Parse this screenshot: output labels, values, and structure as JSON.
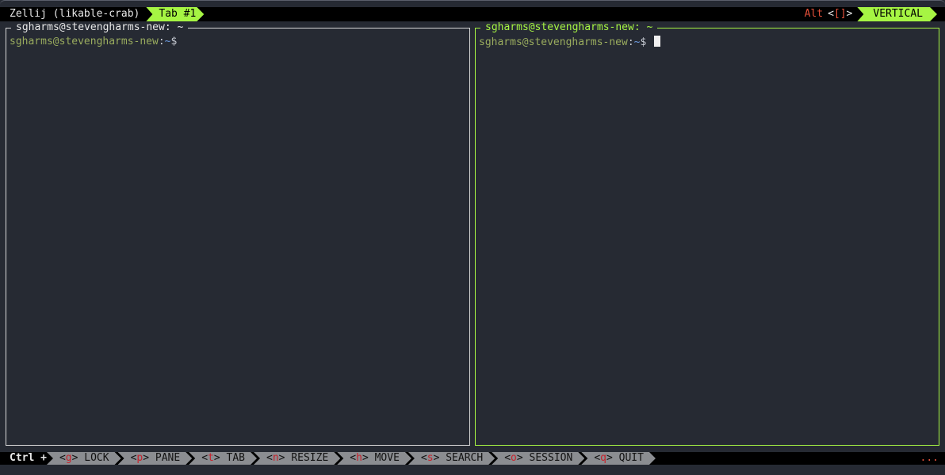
{
  "topbar": {
    "session_name": "Zellij (likable-crab)",
    "active_tab": "Tab #1",
    "alt_label": "Alt",
    "alt_keys_open": "<",
    "alt_keys_mid": "[]",
    "alt_keys_close": ">",
    "mode": "VERTICAL"
  },
  "panes": {
    "left": {
      "title": "sgharms@stevengharms-new: ~",
      "prompt_user": "sgharms@stevengharms-new",
      "prompt_sep": ":",
      "prompt_path": "~",
      "prompt_symbol": "$"
    },
    "right": {
      "title": "sgharms@stevengharms-new: ~",
      "prompt_user": "sgharms@stevengharms-new",
      "prompt_sep": ":",
      "prompt_path": "~",
      "prompt_symbol": "$"
    }
  },
  "bottombar": {
    "modifier": "Ctrl +",
    "hints": [
      {
        "key": "g",
        "label": "LOCK"
      },
      {
        "key": "p",
        "label": "PANE"
      },
      {
        "key": "t",
        "label": "TAB"
      },
      {
        "key": "n",
        "label": "RESIZE"
      },
      {
        "key": "h",
        "label": "MOVE"
      },
      {
        "key": "s",
        "label": "SEARCH"
      },
      {
        "key": "o",
        "label": "SESSION"
      },
      {
        "key": "q",
        "label": "QUIT"
      }
    ],
    "more": "..."
  },
  "colors": {
    "accent": "#a6f543",
    "key_red": "#c8232c",
    "alt_red": "#e5503a",
    "background": "#262a33"
  }
}
